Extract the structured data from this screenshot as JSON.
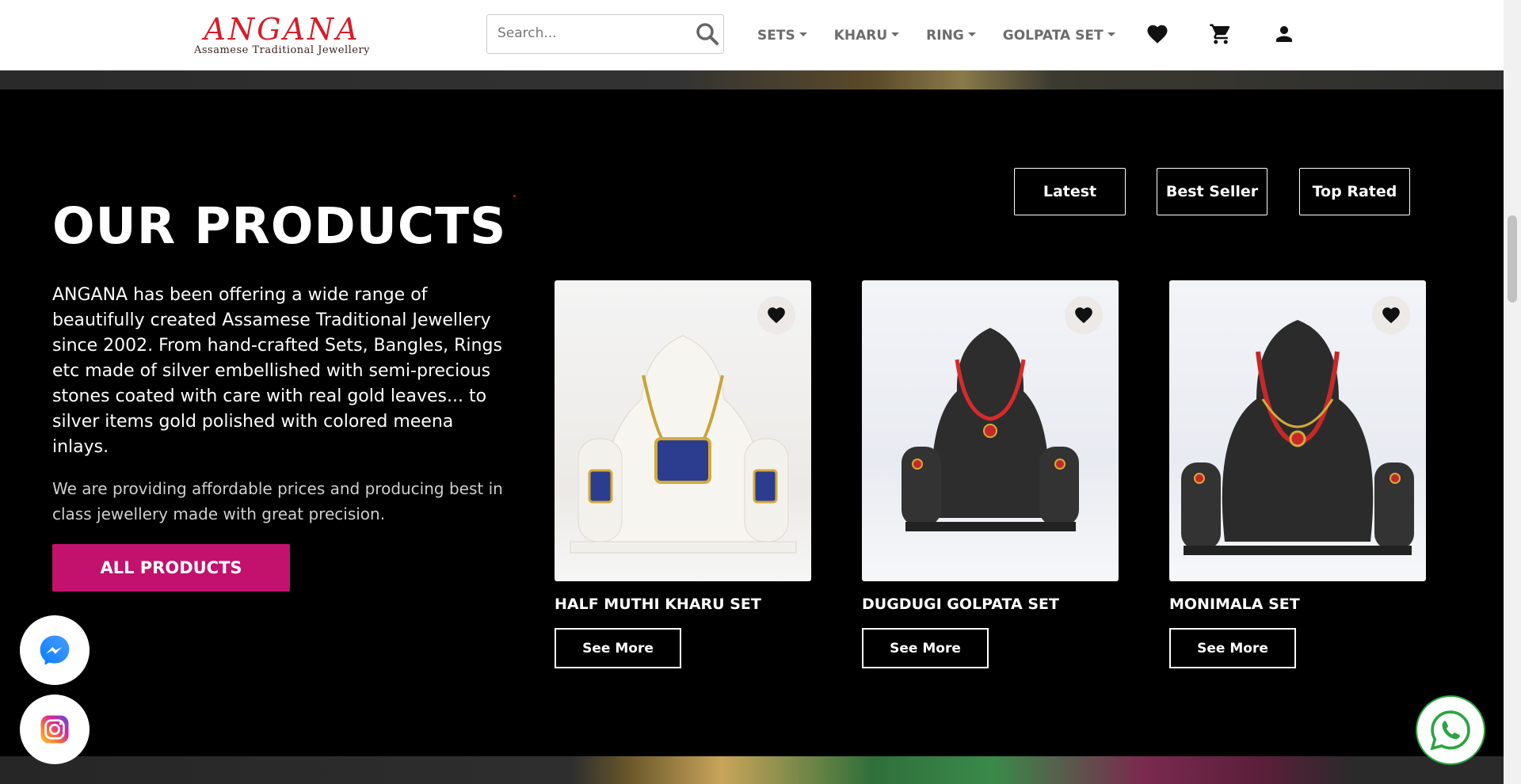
{
  "header": {
    "logo_title": "ANGANA",
    "logo_subtitle": "Assamese Traditional Jewellery",
    "search_placeholder": "Search...",
    "nav": [
      {
        "label": "SETS"
      },
      {
        "label": "KHARU"
      },
      {
        "label": "RING"
      },
      {
        "label": "GOLPATA SET"
      }
    ],
    "icons": [
      "heart-icon",
      "cart-icon",
      "user-icon"
    ]
  },
  "products": {
    "heading": "OUR PRODUCTS",
    "description": "ANGANA has been offering a wide range of beautifully created Assamese Traditional Jewellery since 2002. From hand-crafted Sets, Bangles, Rings etc made of silver embellished with semi-precious stones coated with care with real gold leaves... to silver items gold polished with colored meena inlays.",
    "description_secondary": "We are providing affordable prices and producing best in class jewellery made with great precision.",
    "all_products_label": "ALL PRODUCTS",
    "filters": [
      {
        "label": "Latest"
      },
      {
        "label": "Best Seller"
      },
      {
        "label": "Top Rated"
      }
    ],
    "items": [
      {
        "title": "HALF MUTHI KHARU SET",
        "cta": "See More"
      },
      {
        "title": "DUGDUGI GOLPATA SET",
        "cta": "See More"
      },
      {
        "title": "MONIMALA SET",
        "cta": "See More"
      }
    ]
  },
  "colors": {
    "accent": "#c2126d",
    "logo_red": "#d71d26",
    "whatsapp": "#2aa540"
  }
}
